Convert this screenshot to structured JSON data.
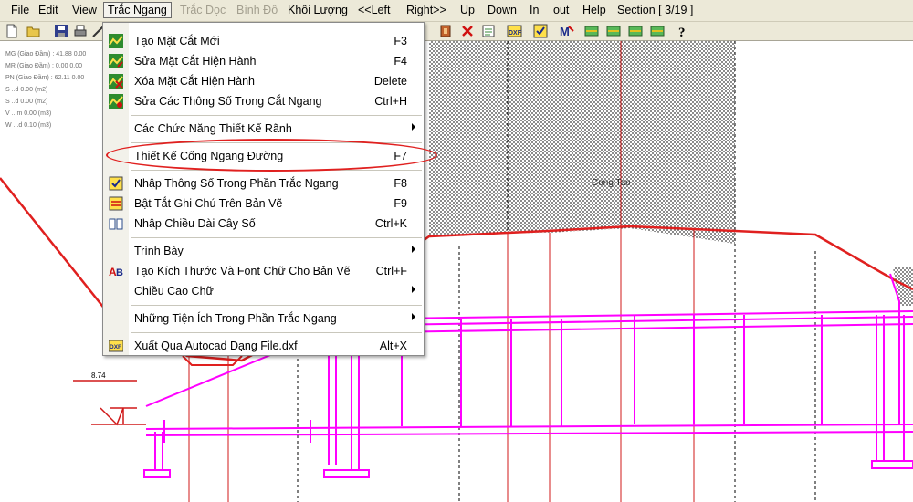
{
  "menubar": {
    "file": "File",
    "edit": "Edit",
    "view": "View",
    "trac_ngang": "Trắc Ngang",
    "trac_doc": "Trắc Dọc",
    "binh_do": "Bình Đồ",
    "khoi_luong": "Khối Lượng",
    "left": "<<Left",
    "right": "Right>>",
    "up": "Up",
    "down": "Down",
    "in": "In",
    "out": "out",
    "help": "Help",
    "section": "Section [ 3/19 ]"
  },
  "toolbar": {
    "icons": [
      "new-file-icon",
      "open-folder-icon",
      "save-icon",
      "print-icon",
      "ruler-icon",
      "box-icon",
      "delete-x-icon",
      "note-icon",
      "dxf-icon",
      "checkbox-icon",
      "m-icon",
      "layer-icon",
      "layer-icon",
      "layer-icon",
      "layer-icon",
      "help-icon"
    ]
  },
  "menu": {
    "items": [
      {
        "label": "Tạo Mặt Cắt Mới",
        "shortcut": "F3",
        "icon": "create-section-icon"
      },
      {
        "label": "Sửa Mặt Cắt Hiện Hành",
        "shortcut": "F4",
        "icon": "edit-section-icon"
      },
      {
        "label": "Xóa Mặt Cắt Hiện Hành",
        "shortcut": "Delete",
        "icon": "delete-section-icon"
      },
      {
        "label": "Sửa Các Thông Số Trong Cắt Ngang",
        "shortcut": "Ctrl+H",
        "icon": "edit-params-icon"
      },
      {
        "label": "Các Chức Năng Thiết Kế Rãnh",
        "submenu": true
      },
      {
        "label": "Thiết Kế Cống Ngang Đường",
        "shortcut": "F7"
      },
      {
        "label": "Nhập Thông Số Trong Phần Trắc Ngang",
        "shortcut": "F8",
        "icon": "input-params-icon"
      },
      {
        "label": "Bật Tắt Ghi Chú Trên Bản Vẽ",
        "shortcut": "F9",
        "icon": "toggle-notes-icon"
      },
      {
        "label": "Nhập Chiều Dài Cây Số",
        "shortcut": "Ctrl+K",
        "icon": "book-icon"
      },
      {
        "label": "Trình Bày",
        "submenu": true
      },
      {
        "label": "Tạo Kích Thước Và Font Chữ Cho Bản Vẽ",
        "shortcut": "Ctrl+F",
        "icon": "font-size-icon"
      },
      {
        "label": "Chiều Cao Chữ",
        "submenu": true
      },
      {
        "label": "Những Tiện Ích Trong Phần Trắc Ngang",
        "submenu": true
      },
      {
        "label": "Xuất Qua Autocad Dạng File.dxf",
        "shortcut": "Alt+X",
        "icon": "dxf-export-icon"
      }
    ]
  },
  "drawing": {
    "info_lines": [
      "MG (Giao Đầm) : 41.88 0.00",
      "MR (Giao Đầm) : 0.00 0.00",
      "PN (Giao Đầm) : 62.11 0.00",
      "S ..d 0.00 (m2)",
      "S ..d 0.00 (m2)",
      "V ...m 0.00 (m3)",
      "W ...d 0.10 (m3)"
    ],
    "dimension_label": "8.74",
    "structure_label": "Cong Tao"
  },
  "colors": {
    "menu_bg": "#ece9d8",
    "ground_line": "#e0201f",
    "culvert": "#ff00ff",
    "grid_line": "#d01818",
    "highlight": "#e0201f"
  }
}
